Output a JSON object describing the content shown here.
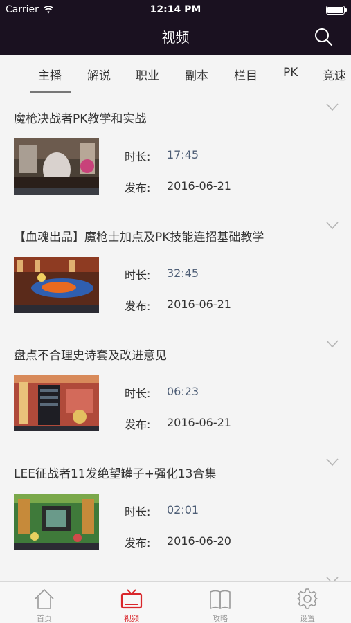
{
  "status_bar": {
    "carrier": "Carrier",
    "time": "12:14 PM"
  },
  "nav": {
    "title": "视频"
  },
  "tabs": [
    "主播",
    "解说",
    "职业",
    "副本",
    "栏目",
    "PK",
    "竞速"
  ],
  "videos": [
    {
      "title": "魔枪决战者PK教学和实战",
      "duration_label": "时长:",
      "duration": "17:45",
      "published_label": "发布:",
      "published": "2016-06-21"
    },
    {
      "title": "【血魂出品】魔枪士加点及PK技能连招基础教学",
      "duration_label": "时长:",
      "duration": "32:45",
      "published_label": "发布:",
      "published": "2016-06-21"
    },
    {
      "title": "盘点不合理史诗套及改进意见",
      "duration_label": "时长:",
      "duration": "06:23",
      "published_label": "发布:",
      "published": "2016-06-21"
    },
    {
      "title": "LEE征战者11发绝望罐子+强化13合集",
      "duration_label": "时长:",
      "duration": "02:01",
      "published_label": "发布:",
      "published": "2016-06-20"
    }
  ],
  "bottom_tabs": [
    {
      "label": "首页",
      "icon": "home-icon"
    },
    {
      "label": "视频",
      "icon": "tv-icon"
    },
    {
      "label": "攻略",
      "icon": "book-icon"
    },
    {
      "label": "设置",
      "icon": "gear-icon"
    }
  ],
  "colors": {
    "nav_bg": "#1a1120",
    "active_tab": "#d9262b",
    "duration_text": "#4e5e76"
  }
}
